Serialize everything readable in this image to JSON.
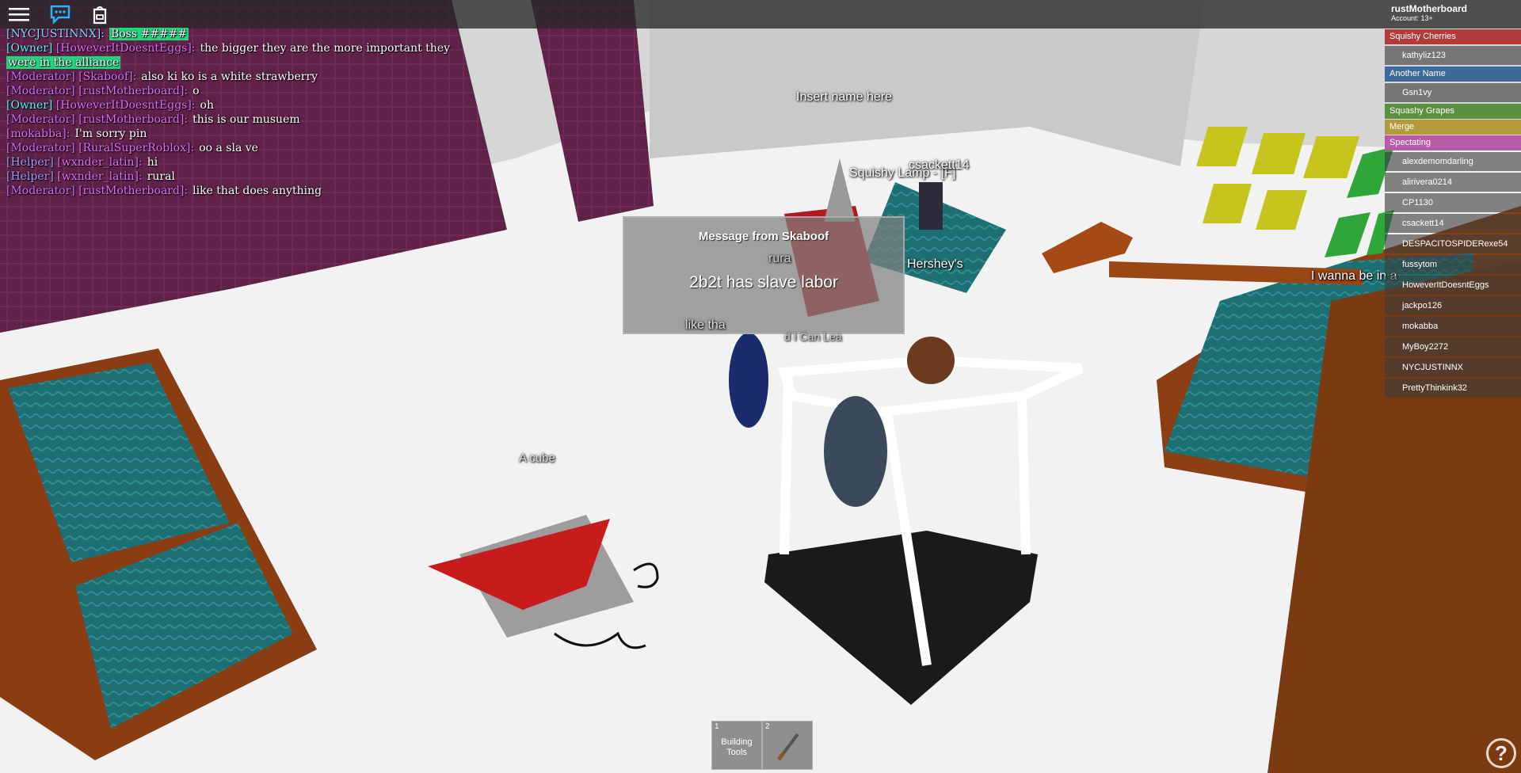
{
  "chat": [
    {
      "tag": "",
      "name": "[NYCJUSTINNX]:",
      "msg": "Boss #####",
      "nameColor": "#7fdcff",
      "hl": true
    },
    {
      "tag": "[Owner]",
      "name": "[HoweverItDoesntEggs]:",
      "msg": "the bigger they are the more important they",
      "nameColor": "#e46cff",
      "tagColor": "#5cf4ff"
    },
    {
      "tag": "",
      "name": "",
      "msg": "were in the alliance",
      "nameColor": "#fff",
      "hl": true
    },
    {
      "tag": "[Moderator]",
      "name": "[Skaboof]:",
      "msg": "also ki ko is a white strawberry",
      "nameColor": "#e46cff",
      "tagColor": "#d56cff"
    },
    {
      "tag": "[Moderator]",
      "name": "[rustMotherboard]:",
      "msg": "o",
      "nameColor": "#e46cff",
      "tagColor": "#d56cff"
    },
    {
      "tag": "[Owner]",
      "name": "[HoweverItDoesntEggs]:",
      "msg": "oh",
      "nameColor": "#e46cff",
      "tagColor": "#5cf4ff"
    },
    {
      "tag": "[Moderator]",
      "name": "[rustMotherboard]:",
      "msg": "this is our musuem",
      "nameColor": "#e46cff",
      "tagColor": "#d56cff"
    },
    {
      "tag": "",
      "name": "[mokabba]:",
      "msg": "I'm sorry pin",
      "nameColor": "#e46cff"
    },
    {
      "tag": "[Moderator]",
      "name": "[RuralSuperRoblox]:",
      "msg": "oo a sla ve",
      "nameColor": "#e46cff",
      "tagColor": "#d56cff"
    },
    {
      "tag": "[Helper]",
      "name": "[wxnder_latin]:",
      "msg": "hi",
      "nameColor": "#e46cff",
      "tagColor": "#9d9dff"
    },
    {
      "tag": "[Helper]",
      "name": "[wxnder_latin]:",
      "msg": "rural",
      "nameColor": "#e46cff",
      "tagColor": "#9d9dff"
    },
    {
      "tag": "[Moderator]",
      "name": "[rustMotherboard]:",
      "msg": "like that does anything",
      "nameColor": "#e46cff",
      "tagColor": "#d56cff"
    }
  ],
  "billboards": {
    "insert_name": "Insert name here",
    "squishy_lamp": "Squishy Lamp - [F]",
    "csackett": "csackett14",
    "hersheys": "Hershey's",
    "cube": "A cube",
    "wanna": "I wanna be in a",
    "rural_frag": "rura",
    "like_frag": "like tha",
    "leave_frag": "d I Can   Lea"
  },
  "message": {
    "title": "Message from Skaboof",
    "body": "2b2t has slave labor"
  },
  "account": {
    "name": "rustMotherboard",
    "age": "Account: 13+"
  },
  "teams": [
    {
      "name": "Squishy Cherries",
      "color": "#b33a3a",
      "players": [
        "kathyliz123"
      ]
    },
    {
      "name": "Another Name",
      "color": "#3c6a99",
      "players": [
        "Gsn1vy"
      ]
    },
    {
      "name": "Squashy Grapes",
      "color": "#5c8f3e",
      "players": []
    },
    {
      "name": "Merge",
      "color": "#b39a3a",
      "players": []
    },
    {
      "name": "Spectating",
      "color": "#b85aa8",
      "players": [
        "alexdemomdarling",
        "alirivera0214",
        "CP1130",
        "csackett14",
        "DESPACITOSPIDERexe54",
        "fussytom",
        "HoweverItDoesntEggs",
        "jackpo126",
        "mokabba",
        "MyBoy2272",
        "NYCJUSTINNX",
        "PrettyThinkink32"
      ]
    }
  ],
  "hotbar": [
    {
      "num": "1",
      "label": "Building Tools"
    },
    {
      "num": "2",
      "label": ""
    }
  ],
  "help_glyph": "?",
  "icons": {
    "menu": "hamburger-menu-icon",
    "chat": "chat-icon",
    "backpack": "backpack-icon",
    "sword": "sword-icon"
  }
}
